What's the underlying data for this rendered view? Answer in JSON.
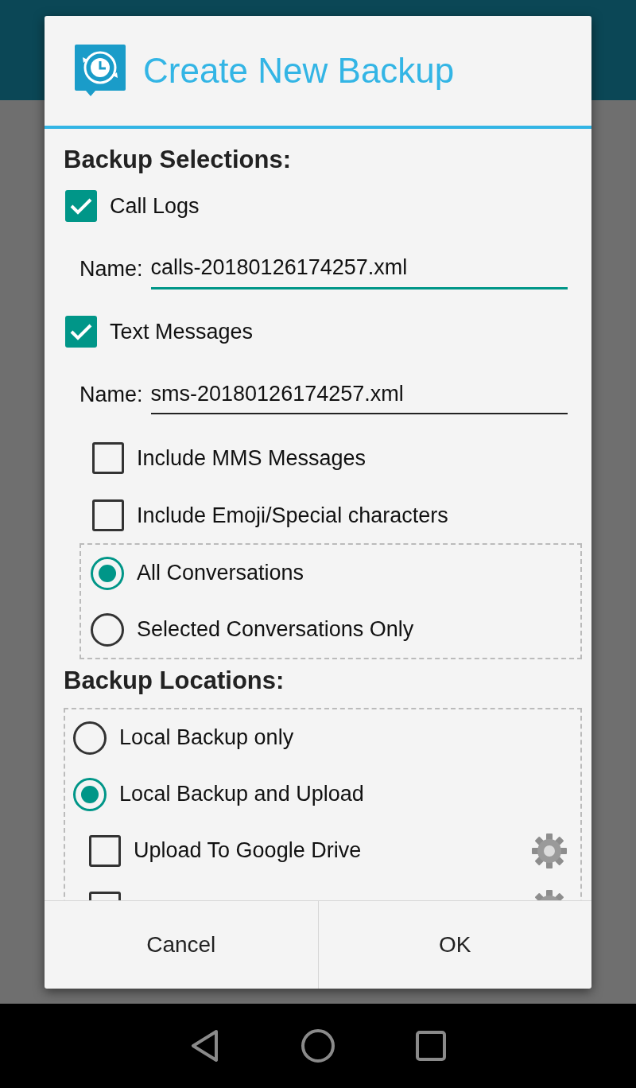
{
  "dialog": {
    "title": "Create New Backup",
    "selections_heading": "Backup Selections:",
    "selections": [
      {
        "kind": "checkbox",
        "label": "Call Logs",
        "checked": true
      },
      {
        "kind": "field",
        "label": "Name:",
        "value": "calls-20180126174257.xml",
        "focused": true
      },
      {
        "kind": "checkbox",
        "label": "Text Messages",
        "checked": true
      },
      {
        "kind": "field",
        "label": "Name:",
        "value": "sms-20180126174257.xml",
        "focused": false
      },
      {
        "kind": "option",
        "label": "Include MMS Messages",
        "checked": false
      },
      {
        "kind": "option",
        "label": "Include Emoji/Special characters",
        "checked": false
      },
      {
        "kind": "radio_group",
        "options": [
          {
            "label": "All Conversations",
            "selected": true
          },
          {
            "label": "Selected Conversations Only",
            "selected": false
          }
        ]
      }
    ],
    "locations_heading": "Backup Locations:",
    "locations": [
      {
        "label": "Local Backup only",
        "selected": false
      },
      {
        "label": "Local Backup and Upload",
        "selected": true
      }
    ],
    "uploads": [
      {
        "label": "Upload To Google Drive",
        "checked": false
      },
      {
        "checked": false
      }
    ],
    "buttons": [
      "Cancel",
      "OK"
    ]
  }
}
